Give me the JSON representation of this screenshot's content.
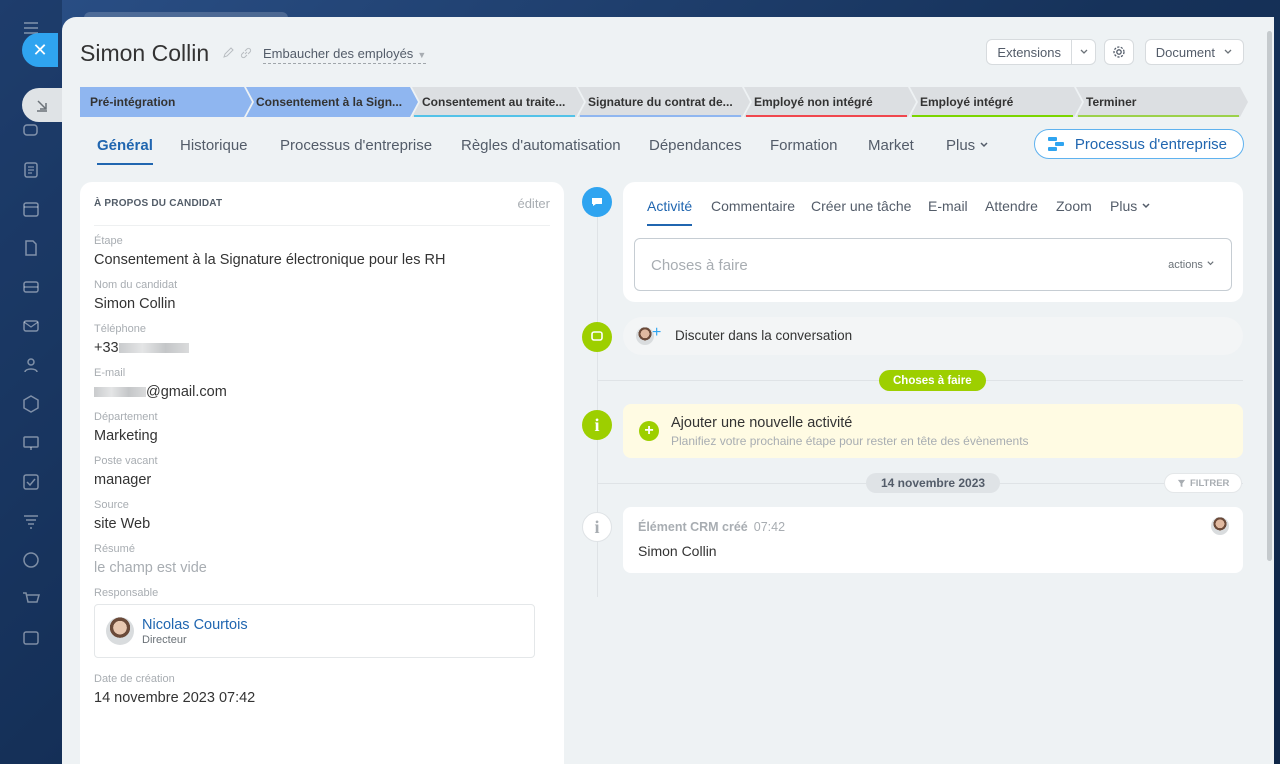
{
  "header": {
    "title": "Simon Collin",
    "pipeline": "Embaucher des employés",
    "extensions_label": "Extensions",
    "document_label": "Document"
  },
  "stages": [
    {
      "label": "Pré-intégration",
      "color": "#8fb6f0",
      "underline": "#8fb6f0"
    },
    {
      "label": "Consentement à la Sign...",
      "color": "#8fb6f0",
      "underline": "#8fb6f0"
    },
    {
      "label": "Consentement au traite...",
      "color": "#dcdfe2",
      "underline": "#53c2e8"
    },
    {
      "label": "Signature du contrat de...",
      "color": "#dcdfe2",
      "underline": "#8fb6f0"
    },
    {
      "label": "Employé non intégré",
      "color": "#dcdfe2",
      "underline": "#f0474e"
    },
    {
      "label": "Employé intégré",
      "color": "#dcdfe2",
      "underline": "#7bd500"
    },
    {
      "label": "Terminer",
      "color": "#dcdfe2",
      "underline": "#9cd14a"
    }
  ],
  "tabs": [
    {
      "label": "Général",
      "active": true
    },
    {
      "label": "Historique"
    },
    {
      "label": "Processus d'entreprise"
    },
    {
      "label": "Règles d'automatisation"
    },
    {
      "label": "Dépendances"
    },
    {
      "label": "Formation"
    },
    {
      "label": "Market"
    },
    {
      "label": "Plus"
    }
  ],
  "bp_button": "Processus d'entreprise",
  "about": {
    "title": "À PROPOS DU CANDIDAT",
    "edit": "éditer",
    "fields": [
      {
        "label": "Étape",
        "value": "Consentement à la Signature électronique pour les RH"
      },
      {
        "label": "Nom du candidat",
        "value": "Simon Collin"
      },
      {
        "label": "Téléphone",
        "value": "+33"
      },
      {
        "label": "E-mail",
        "value": "@gmail.com"
      },
      {
        "label": "Département",
        "value": "Marketing"
      },
      {
        "label": "Poste vacant",
        "value": "manager"
      },
      {
        "label": "Source",
        "value": "site Web"
      },
      {
        "label": "Résumé",
        "value": "le champ est vide"
      }
    ],
    "responsible_label": "Responsable",
    "responsible_name": "Nicolas Courtois",
    "responsible_role": "Directeur",
    "created_label": "Date de création",
    "created_value": "14 novembre 2023 07:42"
  },
  "activity": {
    "tabs": [
      "Activité",
      "Commentaire",
      "Créer une tâche",
      "E-mail",
      "Attendre",
      "Zoom",
      "Plus"
    ],
    "todo_placeholder": "Choses à faire",
    "actions_label": "actions",
    "chat_text": "Discuter dans la conversation",
    "todo_pill": "Choses à faire",
    "new_activity_title": "Ajouter une nouvelle activité",
    "new_activity_sub": "Planifiez votre prochaine étape pour rester en tête des évènements",
    "date_pill": "14 novembre 2023",
    "filter_label": "FILTRER",
    "crm_title": "Élément CRM créé",
    "crm_time": "07:42",
    "crm_name": "Simon Collin"
  },
  "icons": [
    "menu-icon",
    "close-icon",
    "collapse-icon",
    "chat-icon",
    "feed-icon",
    "calendar-icon",
    "document-icon",
    "inbox-icon",
    "mail-icon",
    "contacts-icon",
    "settings-icon",
    "presentation-icon",
    "tasks-icon",
    "filter-icon",
    "cube-icon",
    "cart-icon",
    "chart-icon",
    "pencil-icon",
    "link-icon",
    "gear-icon"
  ]
}
